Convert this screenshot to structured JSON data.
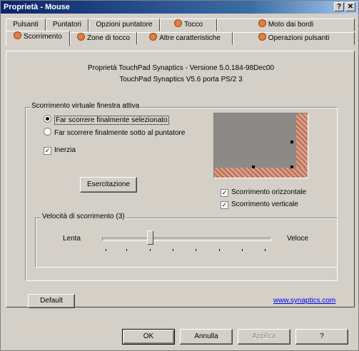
{
  "window": {
    "title": "Proprietà - Mouse",
    "help_btn": "?",
    "close_btn": "✕"
  },
  "tabs_top": [
    {
      "label": "Pulsanti"
    },
    {
      "label": "Puntatori"
    },
    {
      "label": "Opzioni puntatore"
    },
    {
      "label": "Tocco"
    },
    {
      "label": "Moto dai bordi"
    }
  ],
  "tabs_bottom": [
    {
      "label": "Scorrimento"
    },
    {
      "label": "Zone di tocco"
    },
    {
      "label": "Altre caratteristiche"
    },
    {
      "label": "Operazioni pulsanti"
    }
  ],
  "info": {
    "line1": "Proprietà TouchPad Synaptics - Versione 5.0.184-98Dec00",
    "line2": "TouchPad Synaptics V5.6 porta PS/2 3"
  },
  "scroll_group": {
    "legend": "Scorrimento virtuale finestra attiva",
    "radio1": "Far scorrere finalmente selezionato",
    "radio2": "Far scorrere finalmente sotto al puntatore",
    "inertia": "Inerzia",
    "exercise_btn": "Esercitazione",
    "horizontal": "Scorrimento orizzontale",
    "vertical": "Scorrimento verticale"
  },
  "speed_group": {
    "legend": "Velocità di scorrimento (3)",
    "slow": "Lenta",
    "fast": "Veloce",
    "value": 3
  },
  "default_btn": "Default",
  "link": "www.synaptics.com",
  "footer": {
    "ok": "OK",
    "cancel": "Annulla",
    "apply": "Applica",
    "help": "?"
  }
}
